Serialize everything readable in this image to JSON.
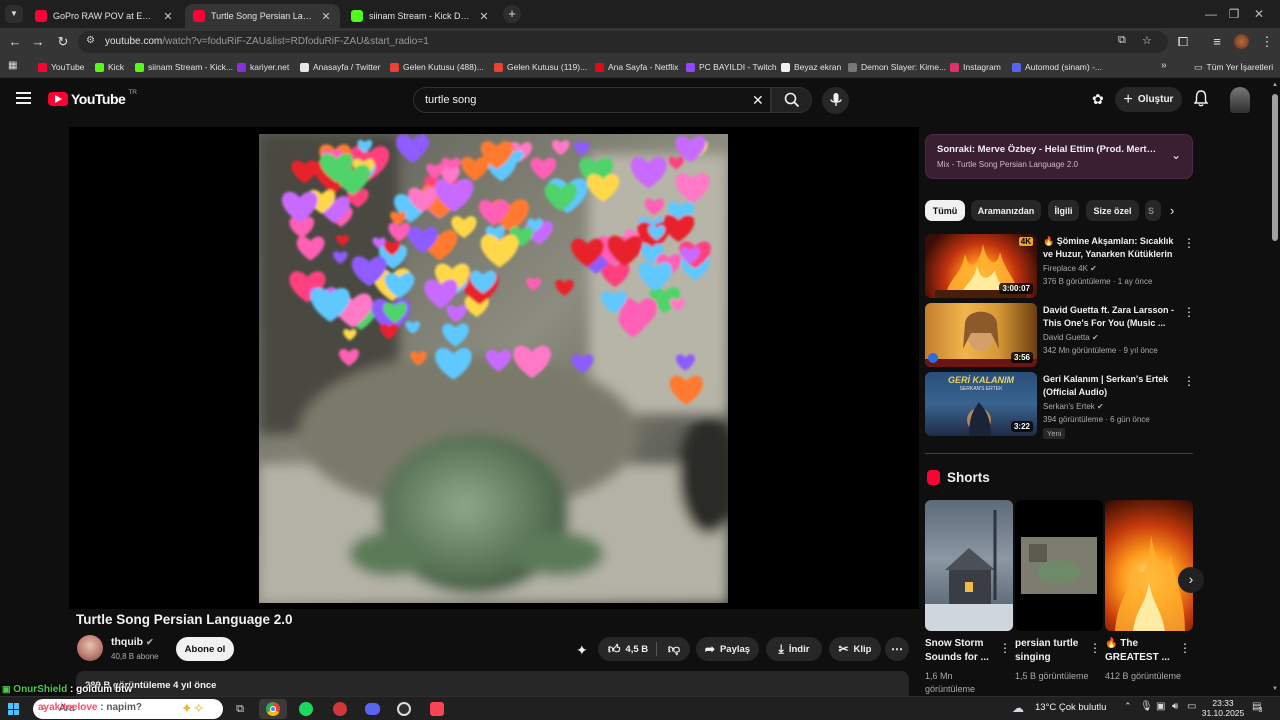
{
  "browser": {
    "tabs": [
      {
        "label": "GoPro RAW POV at Eagle Pass | M",
        "color": "#ff0033"
      },
      {
        "label": "Turtle Song Persian Language 2.0",
        "color": "#ff0033"
      },
      {
        "label": "siinam Stream - Kick Dashboard",
        "color": "#53fc18"
      }
    ],
    "url_main": "youtube.com",
    "url_rest": "/watch?v=foduRiF-ZAU&list=RDfoduRiF-ZAU&start_radio=1",
    "bookmarks": [
      {
        "label": "YouTube",
        "color": "#ff0033"
      },
      {
        "label": "Kick",
        "color": "#53fc18"
      },
      {
        "label": "siinam Stream - Kick...",
        "color": "#53fc18"
      },
      {
        "label": "kariyer.net",
        "color": "#8c2de0"
      },
      {
        "label": "Anasayfa / Twitter",
        "color": "#e6e6e6"
      },
      {
        "label": "Gelen Kutusu (488)...",
        "color": "#ea4335"
      },
      {
        "label": "Gelen Kutusu (119)...",
        "color": "#ea4335"
      },
      {
        "label": "Ana Sayfa - Netflix",
        "color": "#e50914"
      },
      {
        "label": "PC BAYILDI - Twitch",
        "color": "#9146ff"
      },
      {
        "label": "Beyaz ekran",
        "color": "#f1f1f1"
      },
      {
        "label": "Demon Slayer: Kime...",
        "color": "#777777"
      },
      {
        "label": "Instagram",
        "color": "#e1306c"
      },
      {
        "label": "Automod (sinam) -...",
        "color": "#5865f2"
      }
    ],
    "all_bookmarks": "Tüm Yer İşaretleri"
  },
  "youtube": {
    "logo_text": "YouTube",
    "logo_region": "TR",
    "search_query": "turtle song",
    "create_label": "Oluştur"
  },
  "video": {
    "title": "Turtle Song Persian Language 2.0",
    "channel": "thquib",
    "subscribers": "40,8 B abone",
    "subscribe_label": "Abone ol",
    "likes": "4,5 B",
    "share_label": "Paylaş",
    "download_label": "İndir",
    "clip_label": "Klip",
    "views_line": "289 B görüntüleme  4 yıl önce"
  },
  "sidebar": {
    "mix_title": "Sonraki: Merve Özbey - Helal Ettim (Prod. Mert Tunçer)",
    "mix_subtitle": "Mix - Turtle Song Persian Language 2.0",
    "chips": [
      "Tümü",
      "Aramanızdan",
      "İlgili",
      "Size özel",
      "S"
    ],
    "recommendations": [
      {
        "title": "🔥 Şömine Akşamları: Sıcaklık ve Huzur, Yanarken Kütüklerin ...",
        "channel": "Fireplace 4K",
        "meta": "376 B görüntüleme · 1 ay önce",
        "duration": "3:00:07",
        "badge": "4K"
      },
      {
        "title": "David Guetta ft. Zara Larsson - This One's For You (Music ...",
        "channel": "David Guetta",
        "meta": "342 Mn görüntüleme · 9 yıl önce",
        "duration": "3:56"
      },
      {
        "title": "Geri Kalanım | Serkan's Ertek (Official Audio)",
        "channel": "Serkan's Ertek",
        "meta": "394 görüntüleme · 6 gün önce",
        "duration": "3:22",
        "new_badge": "Yeni",
        "thumb_text": "GERİ KALANIM",
        "thumb_sub": "SERKAN'S ERTEK"
      }
    ],
    "shorts_title": "Shorts",
    "shorts": [
      {
        "title": "Snow Storm Sounds for ...",
        "views": "1,6 Mn görüntüleme"
      },
      {
        "title": "persian turtle singing",
        "views": "1,5 B görüntüleme"
      },
      {
        "title": "🔥 The GREATEST ...",
        "views": "412 B görüntüleme"
      }
    ]
  },
  "chat_overlay": [
    {
      "user": "OnurShield",
      "text": ": goldum btw",
      "color": "#4ec94e"
    },
    {
      "user": "ayakiteelove",
      "text": ": napim?",
      "color": "#ff4d6a"
    }
  ],
  "taskbar": {
    "search_placeholder": "Ara",
    "weather": "13°C  Çok bulutlu",
    "time": "23:33",
    "date": "31.10.2025",
    "notif_count": "3"
  }
}
